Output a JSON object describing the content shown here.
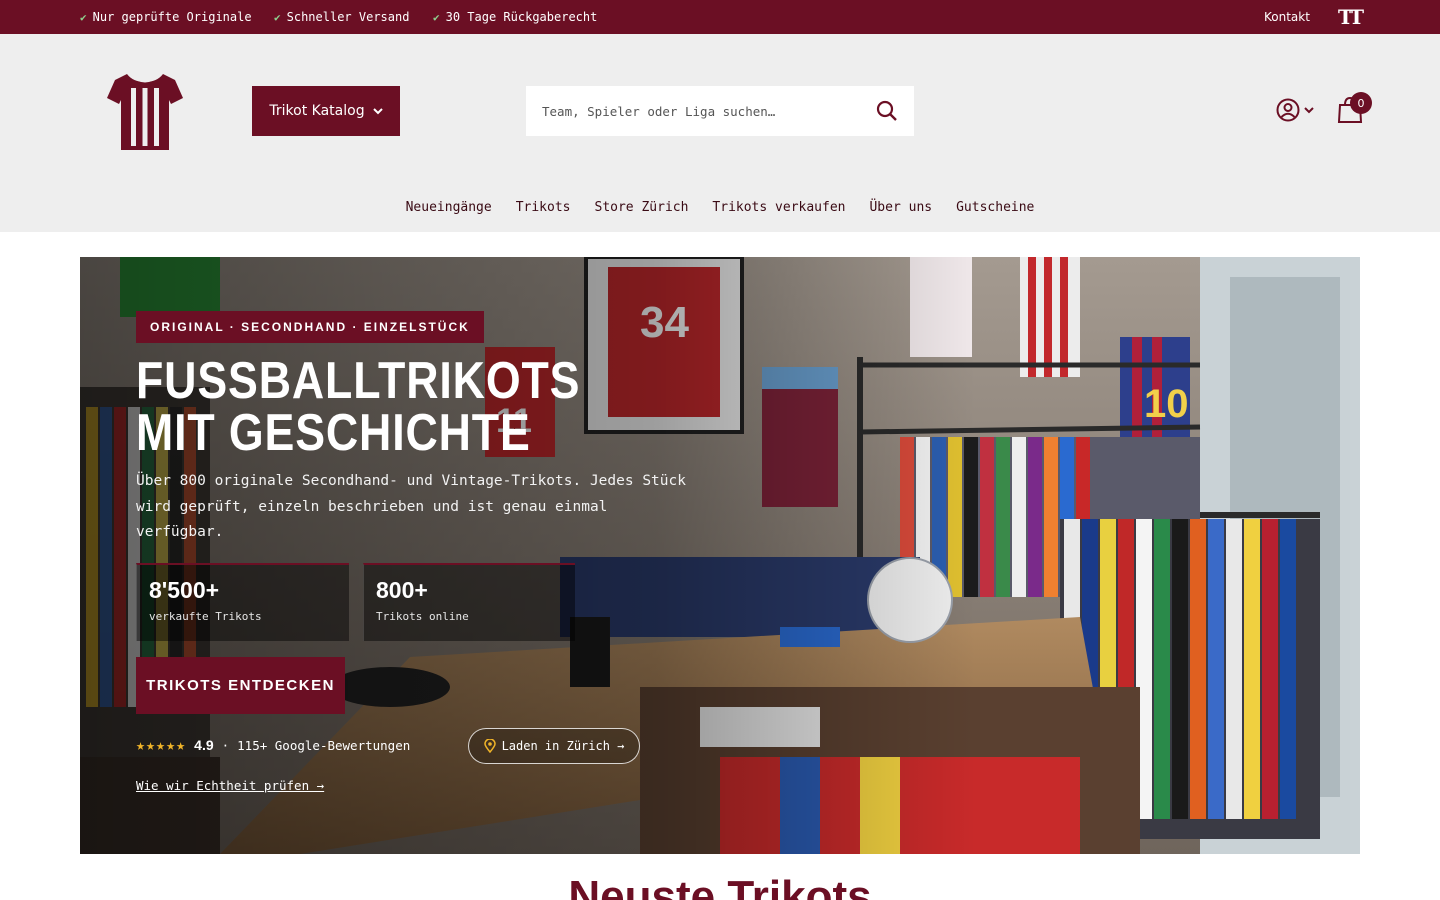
{
  "topbar": {
    "usps": [
      "Nur geprüfte Originale",
      "Schneller Versand",
      "30 Tage Rückgaberecht"
    ],
    "contact": "Kontakt",
    "font_size_icon": "text-size-icon"
  },
  "header": {
    "catalog_button": "Trikot Katalog",
    "search_placeholder": "Team, Spieler oder Liga suchen…",
    "cart_count": "0"
  },
  "nav": [
    "Neueingänge",
    "Trikots",
    "Store Zürich",
    "Trikots verkaufen",
    "Über uns",
    "Gutscheine"
  ],
  "hero": {
    "tag": "ORIGINAL · SECONDHAND · EINZELSTÜCK",
    "title_line1": "FUSSBALLTRIKOTS",
    "title_line2": "MIT GESCHICHTE",
    "text": "Über 800 originale Secondhand- und Vintage-Trikots. Jedes Stück wird geprüft, einzeln beschrieben und ist genau einmal verfügbar.",
    "stats": [
      {
        "value": "8'500+",
        "label": "verkaufte Trikots"
      },
      {
        "value": "800+",
        "label": "Trikots online"
      }
    ],
    "cta": "TRIKOTS ENTDECKEN",
    "rating_stars": "★★★★★",
    "rating_score": "4.9",
    "rating_sep": "·",
    "rating_text": "115+ Google-Bewertungen",
    "store_link": "Laden in Zürich →",
    "auth_link": "Wie wir Echtheit prüfen →"
  },
  "section": {
    "title": "Neuste Trikots"
  },
  "colors": {
    "brand": "#6b0f24",
    "header_bg": "#eeeeee",
    "star": "#f0b429"
  }
}
